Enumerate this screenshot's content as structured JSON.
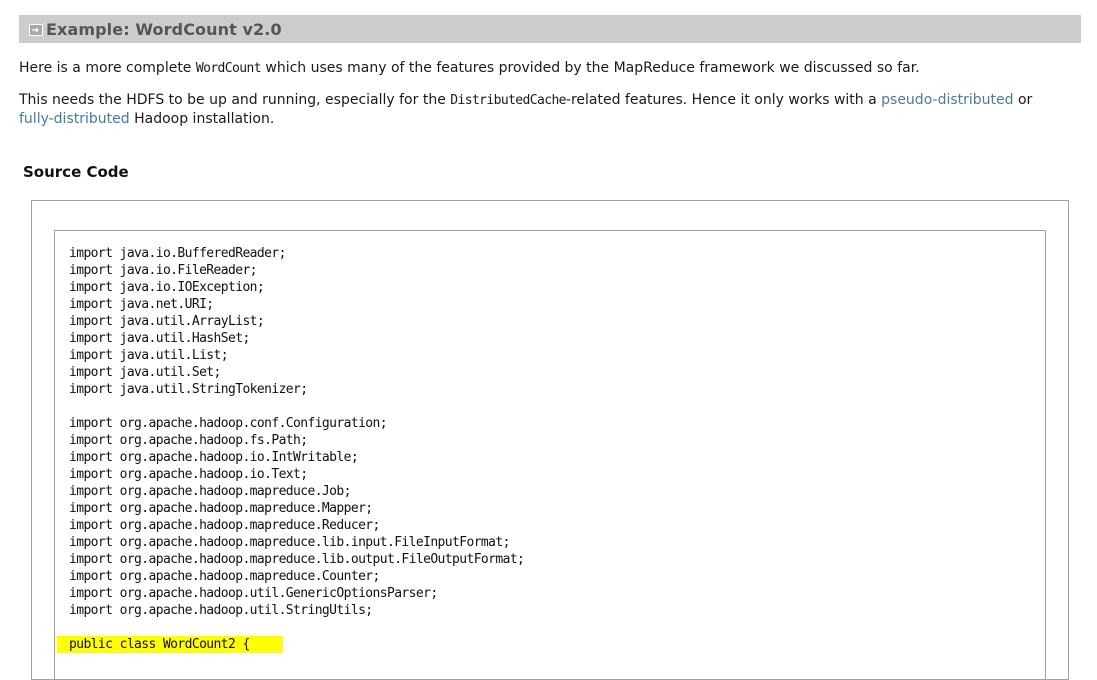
{
  "section": {
    "title": "Example: WordCount v2.0",
    "icon": "expand-icon"
  },
  "intro": {
    "p1_before": "Here is a more complete ",
    "p1_code": "WordCount",
    "p1_after": " which uses many of the features provided by the MapReduce framework we discussed so far.",
    "p2_before": "This needs the HDFS to be up and running, especially for the ",
    "p2_code": "DistributedCache",
    "p2_mid": "-related features. Hence it only works with a ",
    "p2_link1": "pseudo-distributed",
    "p2_or": " or ",
    "p2_link2": "fully-distributed",
    "p2_after": " Hadoop installation."
  },
  "source_code": {
    "heading": "Source Code",
    "lines": [
      "import java.io.BufferedReader;",
      "import java.io.FileReader;",
      "import java.io.IOException;",
      "import java.net.URI;",
      "import java.util.ArrayList;",
      "import java.util.HashSet;",
      "import java.util.List;",
      "import java.util.Set;",
      "import java.util.StringTokenizer;",
      "",
      "import org.apache.hadoop.conf.Configuration;",
      "import org.apache.hadoop.fs.Path;",
      "import org.apache.hadoop.io.IntWritable;",
      "import org.apache.hadoop.io.Text;",
      "import org.apache.hadoop.mapreduce.Job;",
      "import org.apache.hadoop.mapreduce.Mapper;",
      "import org.apache.hadoop.mapreduce.Reducer;",
      "import org.apache.hadoop.mapreduce.lib.input.FileInputFormat;",
      "import org.apache.hadoop.mapreduce.lib.output.FileOutputFormat;",
      "import org.apache.hadoop.mapreduce.Counter;",
      "import org.apache.hadoop.util.GenericOptionsParser;",
      "import org.apache.hadoop.util.StringUtils;",
      "",
      "public class WordCount2 {"
    ],
    "highlighted_line": "public class WordCount2 {",
    "highlight_color": "#ffff00"
  },
  "colors": {
    "header_bg": "#cccccc",
    "header_text": "#555555",
    "link": "#4a78a8"
  }
}
